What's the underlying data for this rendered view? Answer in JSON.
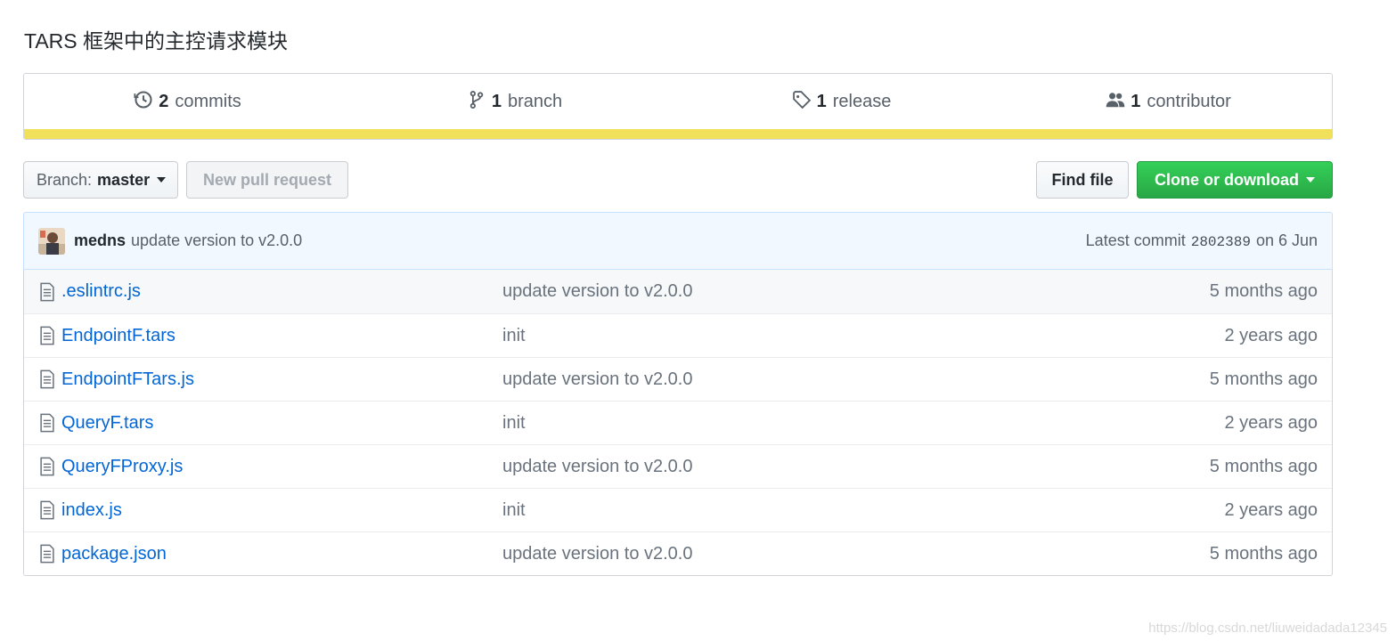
{
  "repo": {
    "description": "TARS 框架中的主控请求模块"
  },
  "summary": {
    "commits": {
      "count": "2",
      "label": "commits"
    },
    "branches": {
      "count": "1",
      "label": "branch"
    },
    "releases": {
      "count": "1",
      "label": "release"
    },
    "contributors": {
      "count": "1",
      "label": "contributor"
    },
    "language_color": "#f1e05a"
  },
  "toolbar": {
    "branch_label": "Branch:",
    "branch_value": "master",
    "new_pr": "New pull request",
    "find_file": "Find file",
    "clone": "Clone or download"
  },
  "latest_commit": {
    "author": "medns",
    "message": "update version to v2.0.0",
    "prefix": "Latest commit",
    "sha": "2802389",
    "date": "on 6 Jun"
  },
  "files": [
    {
      "name": ".eslintrc.js",
      "message": "update version to v2.0.0",
      "age": "5 months ago"
    },
    {
      "name": "EndpointF.tars",
      "message": "init",
      "age": "2 years ago"
    },
    {
      "name": "EndpointFTars.js",
      "message": "update version to v2.0.0",
      "age": "5 months ago"
    },
    {
      "name": "QueryF.tars",
      "message": "init",
      "age": "2 years ago"
    },
    {
      "name": "QueryFProxy.js",
      "message": "update version to v2.0.0",
      "age": "5 months ago"
    },
    {
      "name": "index.js",
      "message": "init",
      "age": "2 years ago"
    },
    {
      "name": "package.json",
      "message": "update version to v2.0.0",
      "age": "5 months ago"
    }
  ],
  "watermark": "https://blog.csdn.net/liuweidadada12345"
}
